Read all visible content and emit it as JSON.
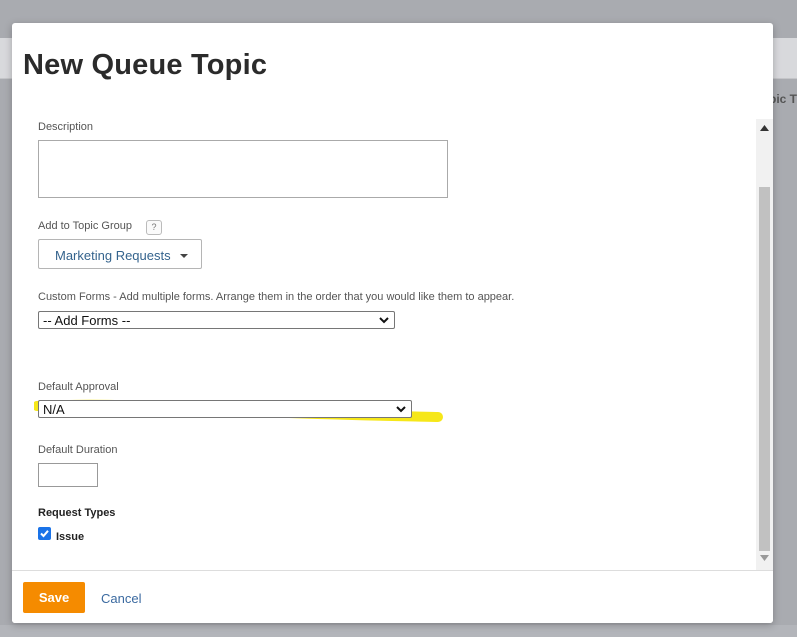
{
  "background": {
    "tab_label": "pic T"
  },
  "modal": {
    "title": "New Queue Topic",
    "description": {
      "label": "Description",
      "value": ""
    },
    "topic_group": {
      "label": "Add to Topic Group",
      "help": "?",
      "selected": "Marketing Requests"
    },
    "custom_forms": {
      "label": "Custom Forms - Add multiple forms. Arrange them in the order that you would like them to appear.",
      "selected": "-- Add Forms --"
    },
    "default_approval": {
      "label": "Default Approval",
      "selected": "N/A"
    },
    "default_duration": {
      "label": "Default Duration",
      "value": ""
    },
    "request_types": {
      "label": "Request Types",
      "items": [
        {
          "label": "Issue",
          "checked": true
        }
      ]
    },
    "footer": {
      "save_label": "Save",
      "cancel_label": "Cancel"
    }
  },
  "colors": {
    "accent": "#f58b00",
    "highlight": "#f5e400",
    "link": "#3b6aa0",
    "checkbox": "#1a73e8"
  }
}
